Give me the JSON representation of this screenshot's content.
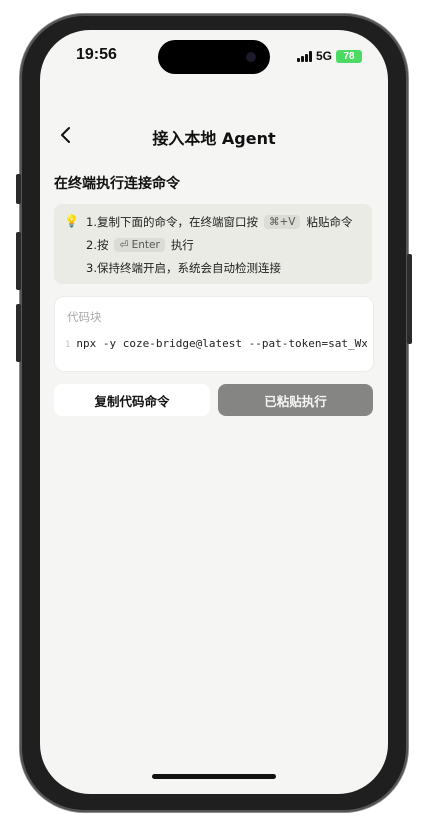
{
  "status_bar": {
    "time": "19:56",
    "network": "5G",
    "battery": "78"
  },
  "nav": {
    "title": "接入本地 Agent"
  },
  "section_title": "在终端执行连接命令",
  "tips": {
    "step1_prefix": "1.复制下面的命令，在终端窗口按",
    "step1_key": "⌘+V",
    "step1_suffix": "粘贴命令",
    "step2_prefix": "2.按",
    "step2_key": "⏎ Enter",
    "step2_suffix": "执行",
    "step3": "3.保持终端开启，系统会自动检测连接"
  },
  "code_block": {
    "label": "代码块",
    "line_number": "1",
    "command": "npx -y coze-bridge@latest --pat-token=sat_Wx"
  },
  "buttons": {
    "copy_label": "复制代码命令",
    "run_label": "已粘贴执行"
  },
  "colors": {
    "accent_disabled": "#858583",
    "tip_background": "#ebebe5",
    "battery": "#4cd964"
  }
}
